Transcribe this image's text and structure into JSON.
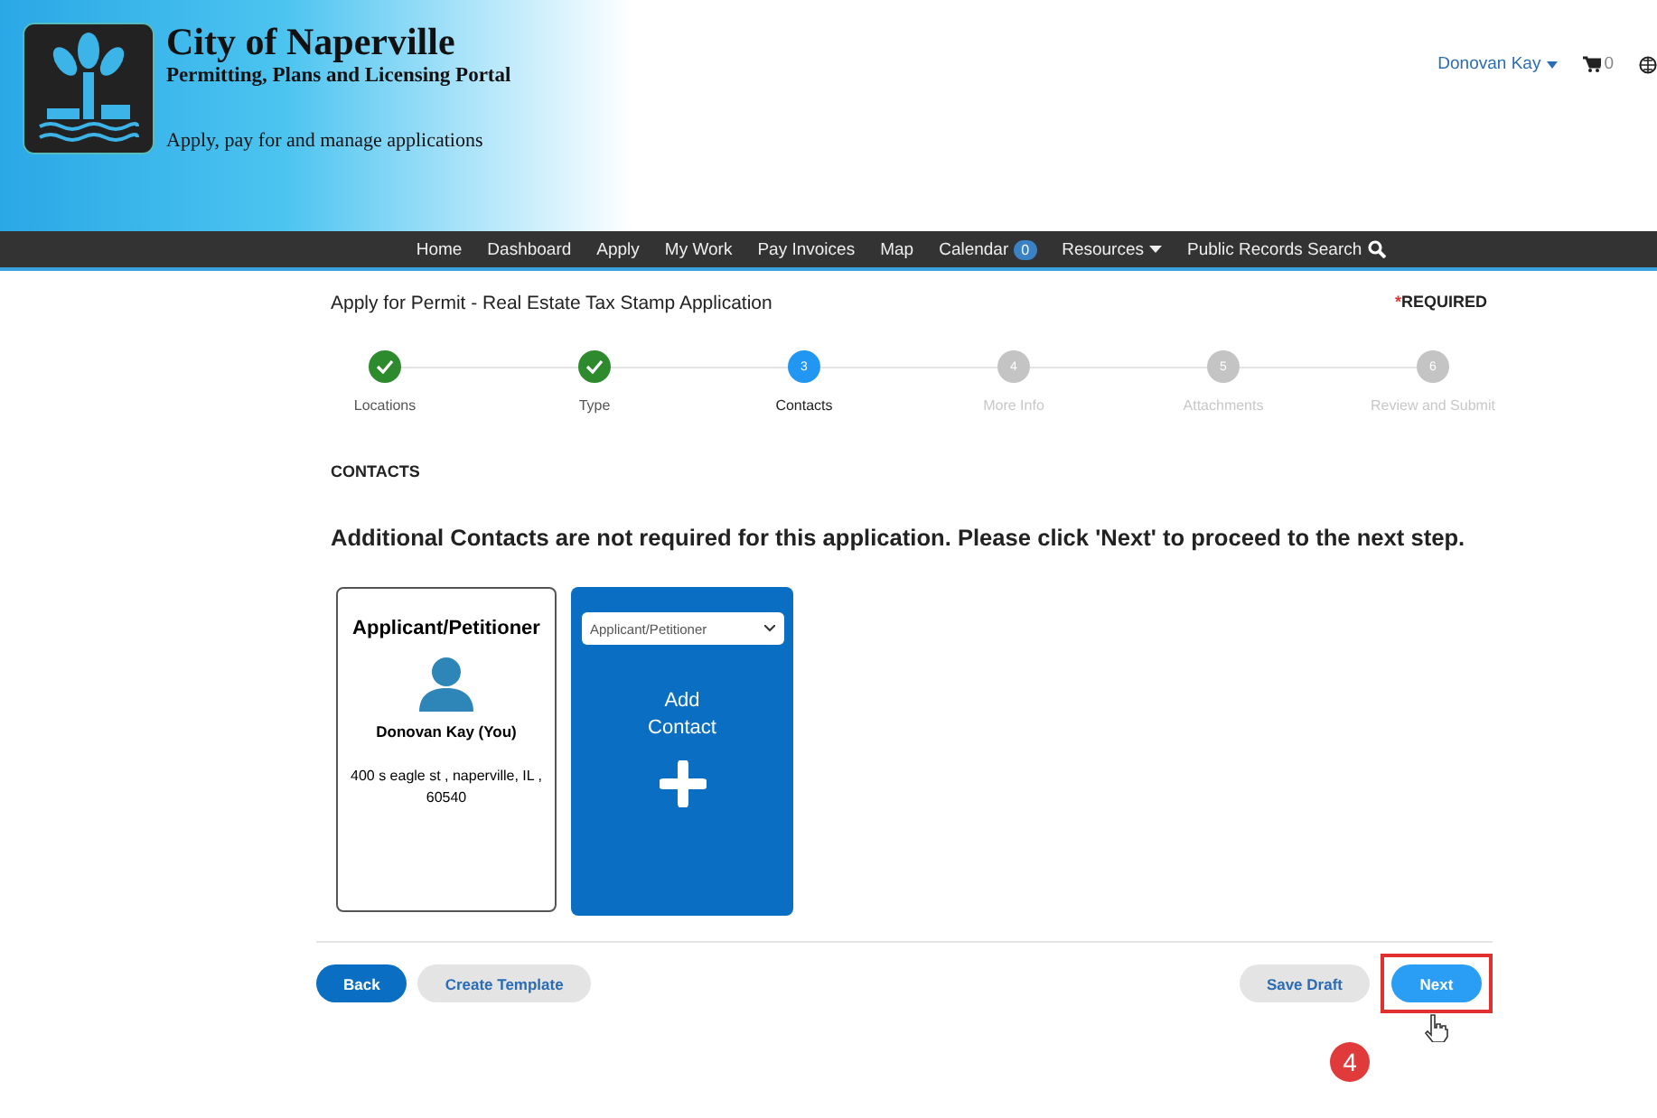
{
  "header": {
    "title": "City of Naperville",
    "subtitle": "Permitting, Plans and Licensing Portal",
    "tagline": "Apply, pay for and manage applications",
    "user": "Donovan Kay",
    "cart_count": "0"
  },
  "nav": [
    {
      "label": "Home",
      "kind": "link"
    },
    {
      "label": "Dashboard",
      "kind": "link"
    },
    {
      "label": "Apply",
      "kind": "link"
    },
    {
      "label": "My Work",
      "kind": "link"
    },
    {
      "label": "Pay Invoices",
      "kind": "link"
    },
    {
      "label": "Map",
      "kind": "link"
    },
    {
      "label": "Calendar",
      "kind": "badge",
      "badge": "0"
    },
    {
      "label": "Resources",
      "kind": "dropdown"
    },
    {
      "label": "Public Records Search",
      "kind": "search"
    }
  ],
  "page": {
    "title": "Apply for Permit - Real Estate Tax Stamp Application",
    "required_mark": "*",
    "required": "REQUIRED"
  },
  "steps": [
    {
      "label": "Locations",
      "kind": "done"
    },
    {
      "label": "Type",
      "kind": "done"
    },
    {
      "label": "Contacts",
      "number": "3",
      "kind": "current"
    },
    {
      "label": "More Info",
      "number": "4",
      "kind": "todo"
    },
    {
      "label": "Attachments",
      "number": "5",
      "kind": "todo"
    },
    {
      "label": "Review and Submit",
      "number": "6",
      "kind": "todo"
    }
  ],
  "section": {
    "heading": "CONTACTS",
    "message": "Additional Contacts are not required for this application. Please click 'Next' to proceed to the next step."
  },
  "contact_card": {
    "role": "Applicant/Petitioner",
    "name": "Donovan Kay (You)",
    "address": "400 s eagle st , naperville, IL , 60540"
  },
  "add_card": {
    "select_value": "Applicant/Petitioner",
    "label": "Add Contact"
  },
  "buttons": [
    {
      "label": "Back",
      "kind": "primary",
      "highlighted": false
    },
    {
      "label": "Create Template",
      "kind": "secondary",
      "highlighted": false
    },
    {
      "label": "Save Draft",
      "kind": "secondary",
      "highlighted": false
    },
    {
      "label": "Next",
      "kind": "next",
      "highlighted": true
    }
  ],
  "callout": {
    "number": "4"
  }
}
